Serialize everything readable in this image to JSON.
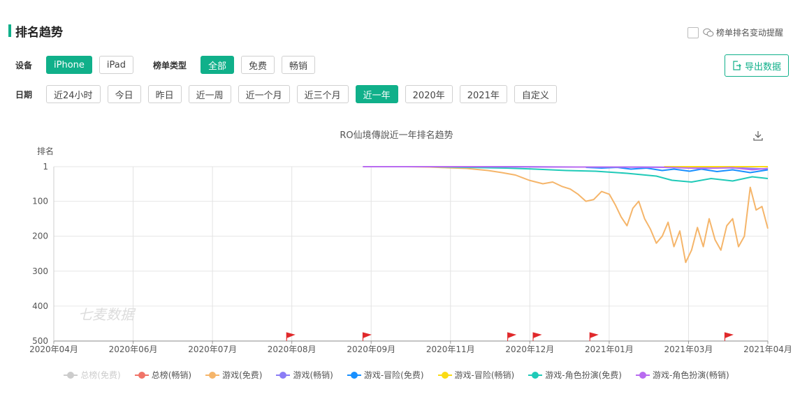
{
  "header": {
    "title": "排名趋势",
    "remind_label": "榜单排名变动提醒"
  },
  "filters": {
    "device_label": "设备",
    "devices": [
      "iPhone",
      "iPad"
    ],
    "device_selected": "iPhone",
    "type_label": "榜单类型",
    "types": [
      "全部",
      "免费",
      "畅销"
    ],
    "type_selected": "全部",
    "date_label": "日期",
    "dates": [
      "近24小时",
      "今日",
      "昨日",
      "近一周",
      "近一个月",
      "近三个月",
      "近一年",
      "2020年",
      "2021年",
      "自定义"
    ],
    "date_selected": "近一年"
  },
  "export_label": "导出数据",
  "watermark": "七麦数据",
  "colors": {
    "accent": "#10b08a"
  },
  "chart_data": {
    "type": "line",
    "title": "RO仙境傳說近一年排名趋势",
    "ylabel": "排名",
    "y_reversed": true,
    "ylim": [
      1,
      500
    ],
    "yticks": [
      "1",
      "100",
      "200",
      "300",
      "400",
      "500"
    ],
    "x_ticks": [
      "2020年04月",
      "2020年06月",
      "2020年07月",
      "2020年08月",
      "2020年09月",
      "2020年11月",
      "2020年12月",
      "2021年01月",
      "2021年03月",
      "2021年04月"
    ],
    "markers": [
      "2020-08-20",
      "2020-09-28",
      "2020-12-11",
      "2020-12-24",
      "2021-01-22",
      "2021-04-01"
    ],
    "series": [
      {
        "name": "总榜(免费)",
        "color": "#cccccc",
        "enabled": false,
        "points": []
      },
      {
        "name": "总榜(畅销)",
        "color": "#f07468",
        "enabled": true,
        "points": []
      },
      {
        "name": "游戏(免费)",
        "color": "#f5b56a",
        "enabled": true,
        "points": [
          [
            "2020-09-28",
            1
          ],
          [
            "2020-10-20",
            1
          ],
          [
            "2020-11-01",
            2
          ],
          [
            "2020-11-10",
            4
          ],
          [
            "2020-11-20",
            6
          ],
          [
            "2020-12-01",
            12
          ],
          [
            "2020-12-08",
            18
          ],
          [
            "2020-12-15",
            25
          ],
          [
            "2020-12-22",
            40
          ],
          [
            "2020-12-29",
            50
          ],
          [
            "2021-01-03",
            45
          ],
          [
            "2021-01-08",
            58
          ],
          [
            "2021-01-12",
            65
          ],
          [
            "2021-01-16",
            80
          ],
          [
            "2021-01-20",
            100
          ],
          [
            "2021-01-24",
            95
          ],
          [
            "2021-01-28",
            72
          ],
          [
            "2021-02-01",
            80
          ],
          [
            "2021-02-04",
            110
          ],
          [
            "2021-02-07",
            145
          ],
          [
            "2021-02-10",
            170
          ],
          [
            "2021-02-13",
            120
          ],
          [
            "2021-02-16",
            100
          ],
          [
            "2021-02-19",
            150
          ],
          [
            "2021-02-22",
            180
          ],
          [
            "2021-02-25",
            220
          ],
          [
            "2021-02-28",
            200
          ],
          [
            "2021-03-03",
            160
          ],
          [
            "2021-03-06",
            230
          ],
          [
            "2021-03-09",
            185
          ],
          [
            "2021-03-12",
            275
          ],
          [
            "2021-03-15",
            240
          ],
          [
            "2021-03-18",
            175
          ],
          [
            "2021-03-21",
            230
          ],
          [
            "2021-03-24",
            150
          ],
          [
            "2021-03-27",
            210
          ],
          [
            "2021-03-30",
            240
          ],
          [
            "2021-04-02",
            170
          ],
          [
            "2021-04-05",
            150
          ],
          [
            "2021-04-08",
            230
          ],
          [
            "2021-04-11",
            200
          ],
          [
            "2021-04-14",
            60
          ],
          [
            "2021-04-17",
            125
          ],
          [
            "2021-04-20",
            115
          ],
          [
            "2021-04-23",
            178
          ]
        ]
      },
      {
        "name": "游戏(畅销)",
        "color": "#8b7cf6",
        "enabled": true,
        "points": [
          [
            "2020-09-28",
            1
          ],
          [
            "2020-11-01",
            1
          ],
          [
            "2020-12-15",
            1
          ],
          [
            "2021-01-15",
            2
          ],
          [
            "2021-02-15",
            2
          ],
          [
            "2021-03-15",
            3
          ],
          [
            "2021-04-10",
            5
          ],
          [
            "2021-04-23",
            8
          ]
        ]
      },
      {
        "name": "游戏-冒险(免费)",
        "color": "#1890ff",
        "enabled": true,
        "points": [
          [
            "2021-01-20",
            3
          ],
          [
            "2021-01-28",
            5
          ],
          [
            "2021-02-05",
            3
          ],
          [
            "2021-02-12",
            8
          ],
          [
            "2021-02-20",
            5
          ],
          [
            "2021-02-28",
            12
          ],
          [
            "2021-03-06",
            8
          ],
          [
            "2021-03-14",
            14
          ],
          [
            "2021-03-20",
            8
          ],
          [
            "2021-03-28",
            15
          ],
          [
            "2021-04-05",
            10
          ],
          [
            "2021-04-14",
            18
          ],
          [
            "2021-04-23",
            10
          ]
        ]
      },
      {
        "name": "游戏-冒险(畅销)",
        "color": "#fadb14",
        "enabled": true,
        "points": [
          [
            "2021-03-01",
            1
          ],
          [
            "2021-03-20",
            1
          ],
          [
            "2021-04-10",
            1
          ],
          [
            "2021-04-23",
            1
          ]
        ]
      },
      {
        "name": "游戏-角色扮演(免费)",
        "color": "#1fcab8",
        "enabled": true,
        "points": [
          [
            "2020-11-01",
            1
          ],
          [
            "2020-11-20",
            3
          ],
          [
            "2020-12-10",
            5
          ],
          [
            "2020-12-25",
            8
          ],
          [
            "2021-01-10",
            12
          ],
          [
            "2021-01-25",
            14
          ],
          [
            "2021-02-10",
            20
          ],
          [
            "2021-02-25",
            28
          ],
          [
            "2021-03-05",
            40
          ],
          [
            "2021-03-15",
            45
          ],
          [
            "2021-03-25",
            35
          ],
          [
            "2021-04-05",
            42
          ],
          [
            "2021-04-15",
            30
          ],
          [
            "2021-04-23",
            35
          ]
        ]
      },
      {
        "name": "游戏-角色扮演(畅销)",
        "color": "#b86bf0",
        "enabled": true,
        "points": [
          [
            "2020-09-28",
            1
          ],
          [
            "2020-11-15",
            1
          ],
          [
            "2021-01-01",
            2
          ],
          [
            "2021-02-01",
            2
          ],
          [
            "2021-03-01",
            3
          ],
          [
            "2021-03-20",
            6
          ],
          [
            "2021-04-05",
            4
          ],
          [
            "2021-04-15",
            10
          ],
          [
            "2021-04-23",
            6
          ]
        ]
      }
    ]
  }
}
